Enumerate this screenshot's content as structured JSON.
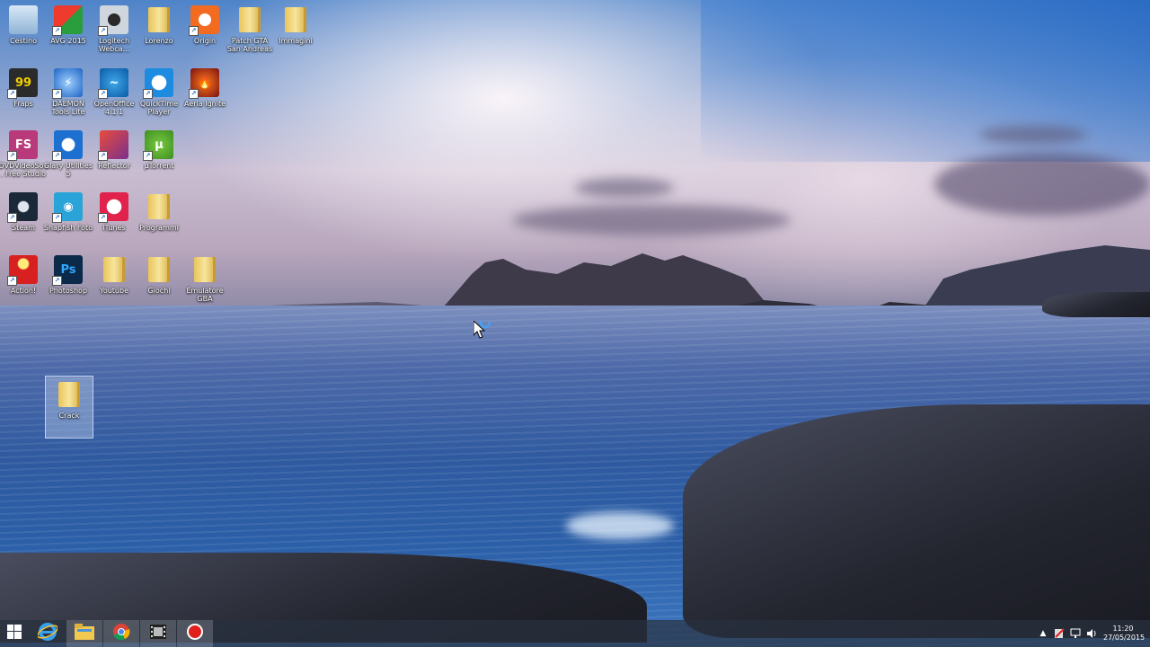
{
  "desktop": {
    "icons": [
      {
        "label": "Cestino",
        "icon": "recycle-bin-icon"
      },
      {
        "label": "AVG 2015",
        "icon": "avg-icon"
      },
      {
        "label": "Logitech Webca...",
        "icon": "webcam-icon"
      },
      {
        "label": "Lorenzo",
        "icon": "folder-icon"
      },
      {
        "label": "Origin",
        "icon": "origin-icon"
      },
      {
        "label": "Patch GTA San Andreas",
        "icon": "folder-icon"
      },
      {
        "label": "Immagini",
        "icon": "folder-icon"
      },
      {
        "label": "Fraps",
        "icon": "fraps-icon"
      },
      {
        "label": "DAEMON Tools Lite",
        "icon": "daemon-tools-icon"
      },
      {
        "label": "OpenOffice 4.1.1",
        "icon": "openoffice-icon"
      },
      {
        "label": "QuickTime Player",
        "icon": "quicktime-icon"
      },
      {
        "label": "Aeria Ignite",
        "icon": "aeria-ignite-icon"
      },
      {
        "label": "DVDVideoSo... Free Studio",
        "icon": "dvdvideosoft-icon"
      },
      {
        "label": "Glary Utilities 5",
        "icon": "glary-utilities-icon"
      },
      {
        "label": "Reflector",
        "icon": "reflector-icon"
      },
      {
        "label": "µTorrent",
        "icon": "utorrent-icon"
      },
      {
        "label": "Steam",
        "icon": "steam-icon"
      },
      {
        "label": "Snapfish Foto",
        "icon": "snapfish-icon"
      },
      {
        "label": "iTunes",
        "icon": "itunes-icon"
      },
      {
        "label": "Programmi",
        "icon": "folder-icon"
      },
      {
        "label": "Action!",
        "icon": "action-icon"
      },
      {
        "label": "Photoshop",
        "icon": "photoshop-icon"
      },
      {
        "label": "Youtube",
        "icon": "folder-icon"
      },
      {
        "label": "Giochi",
        "icon": "folder-icon"
      },
      {
        "label": "Emulatore GBA",
        "icon": "folder-icon"
      },
      {
        "label": "Crack",
        "icon": "folder-icon"
      }
    ]
  },
  "taskbar": {
    "items": [
      {
        "name": "start-button",
        "icon": "windows-logo-icon"
      },
      {
        "name": "internet-explorer-button",
        "icon": "internet-explorer-icon"
      },
      {
        "name": "file-explorer-button",
        "icon": "file-explorer-icon"
      },
      {
        "name": "chrome-button",
        "icon": "chrome-icon"
      },
      {
        "name": "video-app-button",
        "icon": "film-icon"
      },
      {
        "name": "record-button",
        "icon": "record-icon"
      }
    ],
    "clock": {
      "time": "11:20",
      "date": "27/05/2015"
    }
  },
  "colors": {
    "taskbar": "#28303e",
    "accent": "#1a5fb4",
    "record": "#e0201c"
  }
}
